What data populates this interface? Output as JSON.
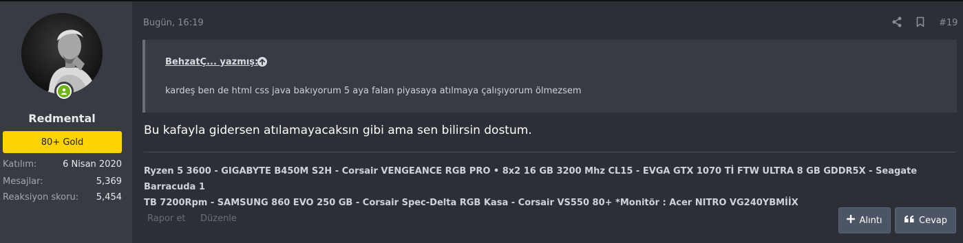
{
  "user": {
    "name": "Redmental",
    "badge": "80+ Gold",
    "stats": [
      {
        "label": "Katılım:",
        "value": "6 Nisan 2020"
      },
      {
        "label": "Mesajlar:",
        "value": "5,369"
      },
      {
        "label": "Reaksiyon skoru:",
        "value": "5,454"
      }
    ]
  },
  "post": {
    "date": "Bugün, 16:19",
    "number": "#19",
    "quote": {
      "author": "BehzatÇ... yazmış:",
      "text": "kardeş ben de html css java bakıyorum 5 aya falan piyasaya atılmaya çalışıyorum ölmezsem"
    },
    "message": "Bu kafayla gidersen atılamayacaksın gibi ama sen bilirsin dostum.",
    "signature_line1": "Ryzen 5 3600 - GIGABYTE B450M S2H - Corsair VENGEANCE RGB PRO • 8x2 16 GB 3200 Mhz CL15 - EVGA GTX 1070 Tİ FTW ULTRA 8 GB GDDR5X - Seagate Barracuda 1",
    "signature_line2": "TB 7200Rpm - SAMSUNG 860 EVO 250 GB - Corsair Spec-Delta RGB Kasa - Corsair VS550 80+ *Monitör : Acer NITRO VG240YBMİİX"
  },
  "actions": {
    "report": "Rapor et",
    "edit": "Düzenle",
    "quote": "Alıntı",
    "reply": "Cevap"
  },
  "icons": {
    "share": "share-icon",
    "bookmark": "bookmark-icon",
    "quote_arrow": "arrow-up-circle-icon",
    "online": "online-status-icon",
    "plus": "plus-icon",
    "reply": "quote-marks-icon"
  },
  "colors": {
    "badge": "#ffd300",
    "online": "#6fb21a",
    "button": "#4b5566"
  }
}
